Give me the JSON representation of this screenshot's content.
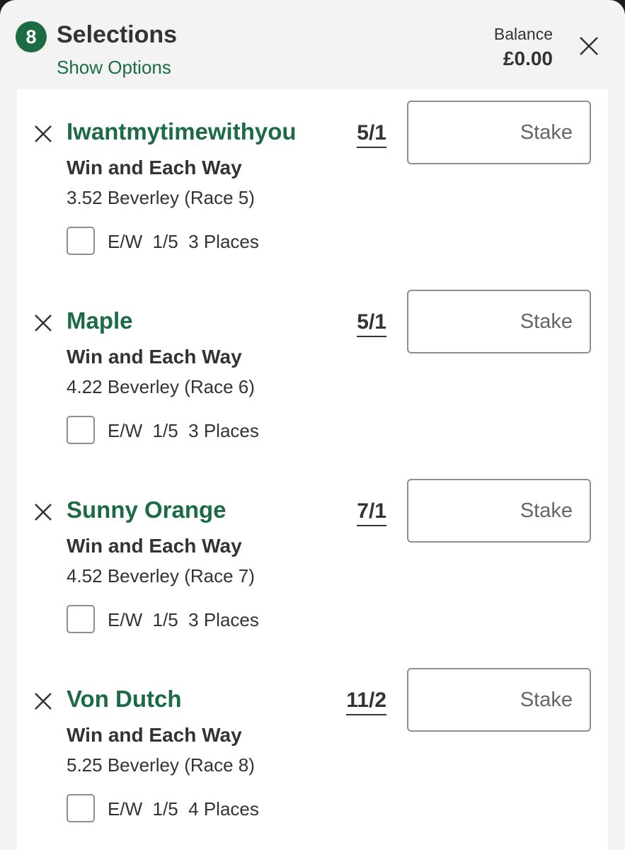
{
  "header": {
    "count": "8",
    "title": "Selections",
    "show_options": "Show Options",
    "balance_label": "Balance",
    "balance_value": "£0.00"
  },
  "selections": [
    {
      "name": "Iwantmytimewithyou",
      "odds": "5/1",
      "stake_placeholder": "Stake",
      "market": "Win and Each Way",
      "event": "3.52 Beverley (Race 5)",
      "ew_terms": "E/W  1/5  3 Places"
    },
    {
      "name": "Maple",
      "odds": "5/1",
      "stake_placeholder": "Stake",
      "market": "Win and Each Way",
      "event": "4.22 Beverley (Race 6)",
      "ew_terms": "E/W  1/5  3 Places"
    },
    {
      "name": "Sunny Orange",
      "odds": "7/1",
      "stake_placeholder": "Stake",
      "market": "Win and Each Way",
      "event": "4.52 Beverley (Race 7)",
      "ew_terms": "E/W  1/5  3 Places"
    },
    {
      "name": "Von Dutch",
      "odds": "11/2",
      "stake_placeholder": "Stake",
      "market": "Win and Each Way",
      "event": "5.25 Beverley (Race 8)",
      "ew_terms": "E/W  1/5  4 Places"
    }
  ],
  "colors": {
    "brand_green": "#1d6b44",
    "text_dark": "#333333",
    "border_grey": "#8f8f8f"
  },
  "icons": {
    "close": "close-icon",
    "remove": "close-icon"
  }
}
